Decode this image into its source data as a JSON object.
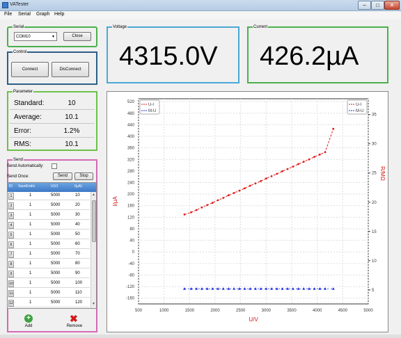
{
  "window": {
    "title": "VATester",
    "min": "–",
    "max": "□",
    "close": "✕"
  },
  "menu": [
    "File",
    "Serial",
    "Graph",
    "Help"
  ],
  "serial": {
    "label": "Serial",
    "port": "COM10",
    "close_label": "Close"
  },
  "control": {
    "label": "Control",
    "connect_label": "Connect",
    "disconnect_label": "DisConnect"
  },
  "voltage": {
    "label": "Voltage",
    "value": "4315.0V"
  },
  "current": {
    "label": "Current",
    "value": "426.2µA"
  },
  "parameter": {
    "label": "Parameter",
    "rows": [
      {
        "label": "Standard:",
        "value": "10"
      },
      {
        "label": "Average:",
        "value": "10.1"
      },
      {
        "label": "Error:",
        "value": "1.2%"
      },
      {
        "label": "RMS:",
        "value": "10.1"
      }
    ]
  },
  "send": {
    "label": "Send",
    "auto_label": "Send Automatically:",
    "once_label": "Send Once:",
    "send_label": "Send",
    "stop_label": "Stop",
    "columns": [
      "ID",
      "SaveEnd/s",
      "U(V)",
      "I(µA)"
    ],
    "rows": [
      [
        "1",
        "1",
        "5000",
        "10"
      ],
      [
        "2",
        "1",
        "5000",
        "20"
      ],
      [
        "3",
        "1",
        "5000",
        "30"
      ],
      [
        "4",
        "1",
        "5000",
        "40"
      ],
      [
        "5",
        "1",
        "5000",
        "50"
      ],
      [
        "6",
        "1",
        "5000",
        "60"
      ],
      [
        "7",
        "1",
        "5000",
        "70"
      ],
      [
        "8",
        "1",
        "5000",
        "80"
      ],
      [
        "9",
        "1",
        "5000",
        "90"
      ],
      [
        "10",
        "1",
        "5000",
        "100"
      ],
      [
        "11",
        "1",
        "5000",
        "110"
      ],
      [
        "12",
        "1",
        "5000",
        "120"
      ]
    ],
    "add_label": "Add",
    "remove_label": "Remove"
  },
  "colors": {
    "series_ui": "#e01818",
    "series_mu": "#1828e0",
    "right_axis": "#d01818"
  },
  "chart_data": {
    "type": "scatter",
    "xlabel": "U/V",
    "ylabel": "I/µA",
    "y2label": "R/MΩ",
    "xlim": [
      500,
      5000
    ],
    "ylim": [
      -180,
      530
    ],
    "y2lim": [
      2.6,
      37.7
    ],
    "xticks": [
      500,
      1000,
      1500,
      2000,
      2500,
      3000,
      3500,
      4000,
      4500,
      5000
    ],
    "yticks": [
      520,
      480,
      440,
      400,
      360,
      320,
      280,
      240,
      200,
      160,
      120,
      80,
      40,
      0,
      -40,
      -80,
      -120,
      -160
    ],
    "y2ticks": [
      35,
      30,
      25,
      20,
      15,
      10,
      5
    ],
    "grid": true,
    "legend_left": [
      "U-I",
      "M-U"
    ],
    "legend_right": [
      "U-I",
      "M-U"
    ],
    "legend_placement": "top-left and top-right",
    "series": [
      {
        "name": "U-I",
        "axis": "left",
        "x": [
          1400,
          1530,
          1635,
          1740,
          1845,
          1950,
          2055,
          2160,
          2265,
          2370,
          2475,
          2580,
          2685,
          2790,
          2895,
          3000,
          3105,
          3210,
          3315,
          3420,
          3525,
          3630,
          3735,
          3840,
          3945,
          4050,
          4155,
          4315
        ],
        "y": [
          129.5,
          137,
          145,
          154,
          162,
          170,
          179,
          187,
          196,
          204,
          212,
          220,
          229,
          237,
          245,
          254,
          262,
          270,
          279,
          287,
          295,
          304,
          312,
          320,
          329,
          337,
          345,
          426
        ]
      },
      {
        "name": "M-U",
        "axis": "right",
        "x": [
          1400,
          1530,
          1635,
          1740,
          1845,
          1950,
          2055,
          2160,
          2265,
          2370,
          2475,
          2580,
          2685,
          2790,
          2895,
          3000,
          3105,
          3210,
          3315,
          3420,
          3525,
          3630,
          3735,
          3840,
          3945,
          4050,
          4155,
          4315
        ],
        "y": [
          5.2,
          5.2,
          5.2,
          5.2,
          5.2,
          5.2,
          5.2,
          5.2,
          5.2,
          5.2,
          5.2,
          5.2,
          5.2,
          5.2,
          5.2,
          5.2,
          5.2,
          5.2,
          5.2,
          5.2,
          5.2,
          5.2,
          5.2,
          5.2,
          5.2,
          5.2,
          5.2,
          5.2
        ]
      }
    ]
  }
}
